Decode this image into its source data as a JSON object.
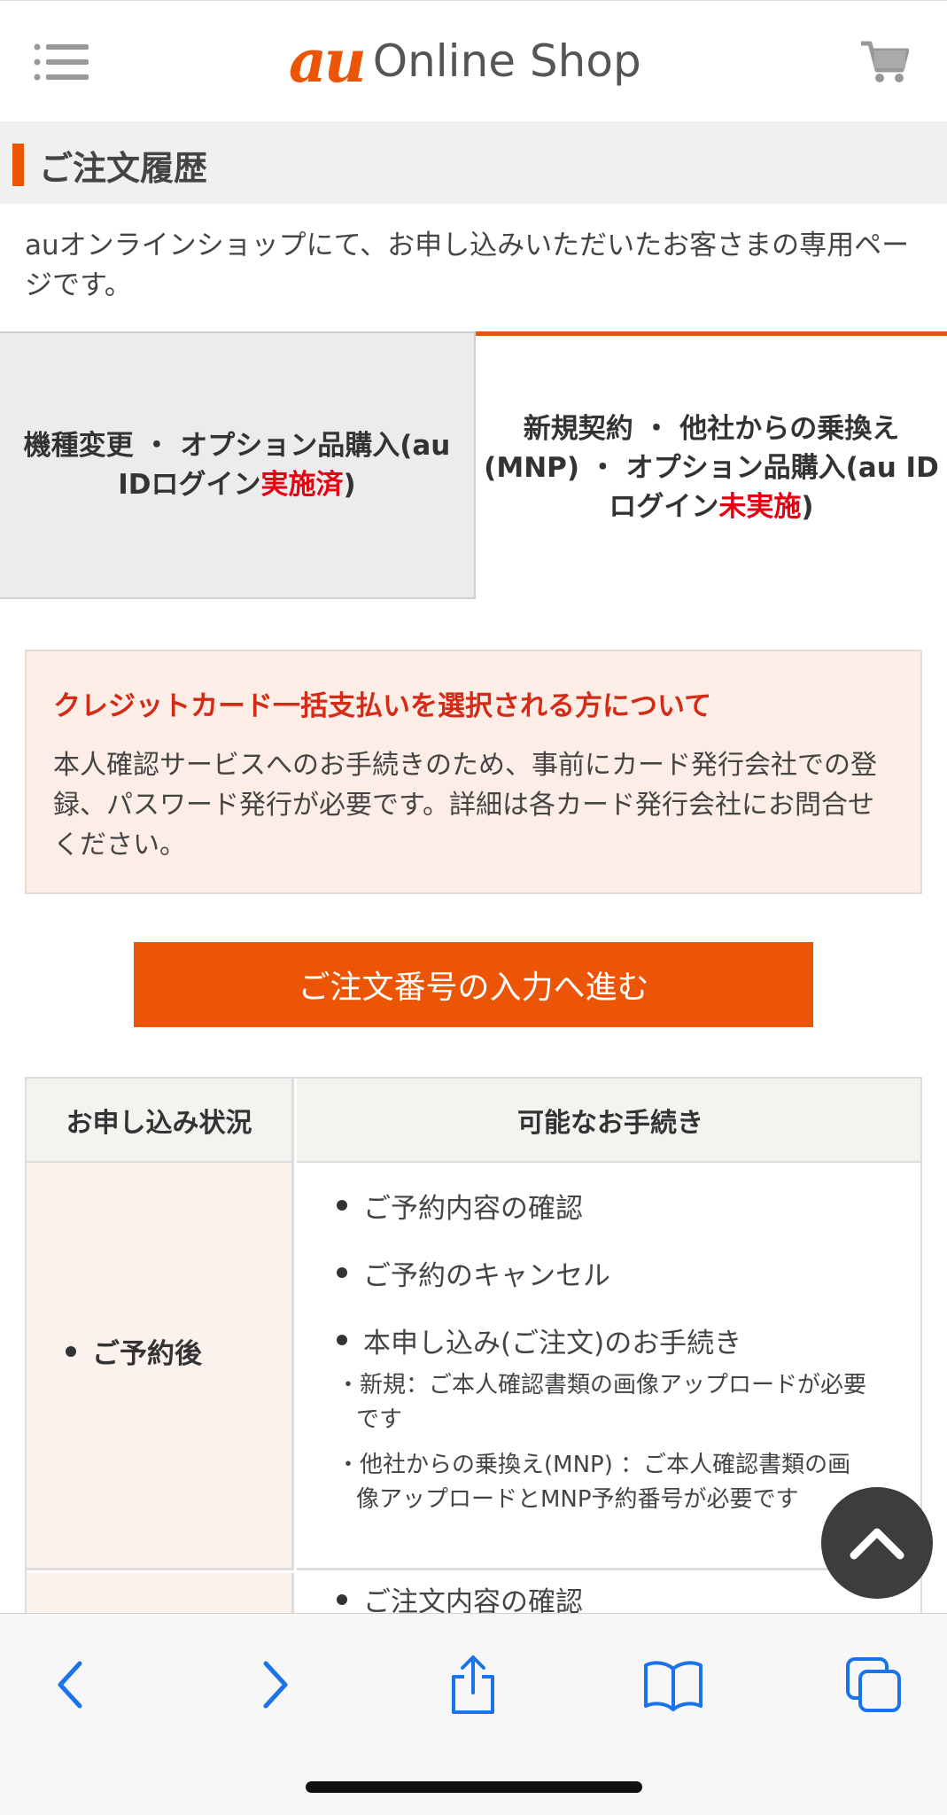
{
  "header": {
    "logo_au": "au",
    "logo_text": "Online Shop",
    "menu_icon": "hamburger-menu-icon",
    "cart_icon": "cart-icon",
    "brand_color": "#eb5505"
  },
  "section": {
    "title": "ご注文履歴",
    "intro": "auオンラインショップにて、お申し込みいただいたお客さまの専用ページです。"
  },
  "tabs": [
    {
      "label_before": "機種変更 ・ オプション品購入(au IDログイン",
      "label_status": "実施済",
      "label_after": ")",
      "selected": false
    },
    {
      "label_before": "新規契約 ・ 他社からの乗換え(MNP) ・ オプション品購入(au IDログイン",
      "label_status": "未実施",
      "label_after": ")",
      "selected": true
    }
  ],
  "notice": {
    "title": "クレジットカード一括支払いを選択される方について",
    "body": "本人確認サービスへのお手続きのため、事前にカード発行会社での登録、パスワード発行が必要です。詳細は各カード発行会社にお問合せください。"
  },
  "cta": {
    "label": "ご注文番号の入力へ進む"
  },
  "table": {
    "headers": [
      "お申し込み状況",
      "可能なお手続き"
    ],
    "rows": [
      {
        "status": "ご予約後",
        "procedures": [
          "ご予約内容の確認",
          "ご予約のキャンセル",
          "本申し込み(ご注文)のお手続き"
        ],
        "notes": [
          "・新規：ご本人確認書類の画像アップロードが必要です",
          "・他社からの乗換え(MNP) ：ご本人確認書類の画像アップロードとMNP予約番号が必要です"
        ]
      },
      {
        "status": "",
        "procedures": [
          "ご注文内容の確認"
        ]
      }
    ]
  },
  "browser_toolbar": {
    "icons": [
      "back-icon",
      "forward-icon",
      "share-icon",
      "bookmarks-icon",
      "tabs-icon"
    ],
    "accent": "#1a73e8"
  }
}
